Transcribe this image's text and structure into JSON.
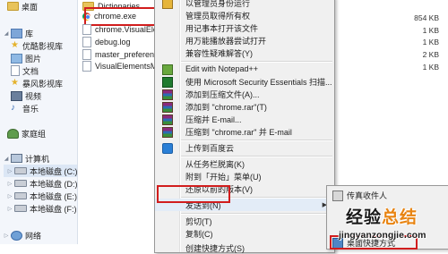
{
  "nav": {
    "desktop": "桌面",
    "library": "库",
    "youku": "优酷影视库",
    "pictures": "图片",
    "documents": "文档",
    "baofeng": "暴风影视库",
    "videos": "视频",
    "music": "音乐",
    "homegroup": "家庭组",
    "computer": "计算机",
    "drive_c": "本地磁盘 (C:)",
    "drive_d": "本地磁盘 (D:)",
    "drive_e": "本地磁盘 (E:)",
    "drive_f": "本地磁盘 (F:)",
    "network": "网络"
  },
  "files": [
    {
      "name": "Dictionaries",
      "size": ""
    },
    {
      "name": "chrome.exe",
      "size": "854 KB"
    },
    {
      "name": "chrome.VisualElements",
      "size": "1 KB"
    },
    {
      "name": "debug.log",
      "size": "1 KB"
    },
    {
      "name": "master_preferences",
      "size": "2 KB"
    },
    {
      "name": "VisualElementsManifest",
      "size": "1 KB"
    }
  ],
  "menu": {
    "top_cut": "以管理员身份运行",
    "admin_owner": "管理员取得所有权",
    "notepad_open": "用记事本打开该文件",
    "player_open": "用万能播放器尝试打开",
    "compat": "兼容性疑难解答(Y)",
    "notepadpp": "Edit with Notepad++",
    "mse_scan": "使用 Microsoft Security Essentials 扫描...",
    "add_archive": "添加到压缩文件(A)...",
    "add_rar": "添加到 \"chrome.rar\"(T)",
    "zip_email": "压缩并 E-mail...",
    "zip_rar_email": "压缩到 \"chrome.rar\" 并 E-mail",
    "baidu_upload": "上传到百度云",
    "unpin_taskbar": "从任务栏脱离(K)",
    "pin_start": "附到「开始」菜单(U)",
    "restore_prev": "还原以前的版本(V)",
    "send_to": "发送到(N)",
    "cut": "剪切(T)",
    "copy": "复制(C)",
    "create_shortcut": "创建快捷方式(S)"
  },
  "submenu": {
    "fax": "传真收件人",
    "desktop_shortcut": "桌面快捷方式"
  },
  "watermark": {
    "brand_a": "经验",
    "brand_b": "总结",
    "url": "jingyanzongjie.com"
  }
}
